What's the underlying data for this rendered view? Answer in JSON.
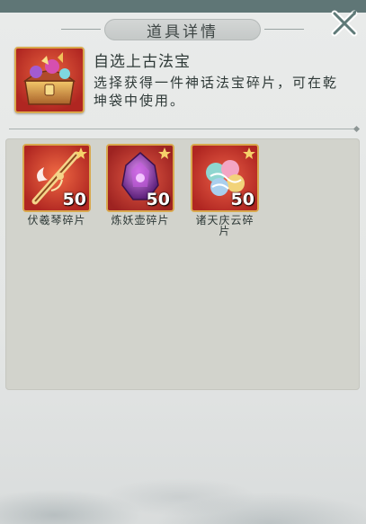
{
  "dialog": {
    "title": "道具详情"
  },
  "item": {
    "name": "自选上古法宝",
    "description": "选择获得一件神话法宝碎片，可在乾坤袋中使用。",
    "icon": "treasure-chest-icon"
  },
  "rewards": [
    {
      "name": "伏羲琴碎片",
      "count": "50",
      "icon": "fuxi-zither-icon"
    },
    {
      "name": "炼妖壶碎片",
      "count": "50",
      "icon": "demon-pot-icon"
    },
    {
      "name": "诸天庆云碎片",
      "count": "50",
      "icon": "auspicious-cloud-icon"
    }
  ],
  "colors": {
    "frame_red": "#c5322c",
    "frame_gold": "#d9a94e",
    "panel_bg": "#e6e8e8",
    "reward_area": "#d2d3cc",
    "text": "#2f3a38"
  }
}
